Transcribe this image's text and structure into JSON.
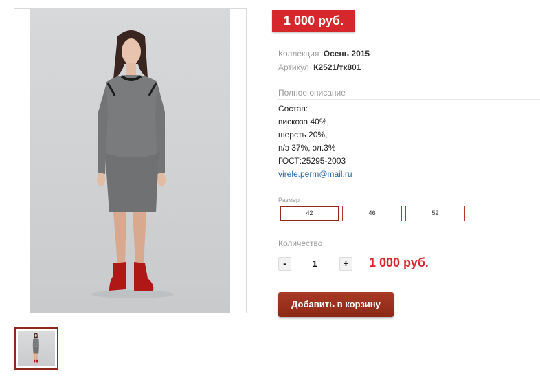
{
  "product": {
    "price_badge": "1 000 руб.",
    "collection_label": "Коллекция",
    "collection_value": "Осень 2015",
    "article_label": "Артикул",
    "article_value": "К2521/тк801"
  },
  "description": {
    "title": "Полное описание",
    "lines": [
      "Состав:",
      "вискоза 40%,",
      "шерсть 20%,",
      "п/э 37%, эл.3%",
      "ГОСТ:25295-2003"
    ],
    "email": "virele.perm@mail.ru"
  },
  "sizes": {
    "label": "Размер",
    "options": [
      "42",
      "46",
      "52"
    ],
    "selected": "42"
  },
  "quantity": {
    "label": "Количество",
    "minus": "-",
    "value": "1",
    "plus": "+",
    "total": "1 000 руб."
  },
  "cart": {
    "add_label": "Добавить в корзину"
  },
  "colors": {
    "accent_red": "#d6272d",
    "button_dark_red": "#8d2816",
    "link_blue": "#2a6bab"
  }
}
